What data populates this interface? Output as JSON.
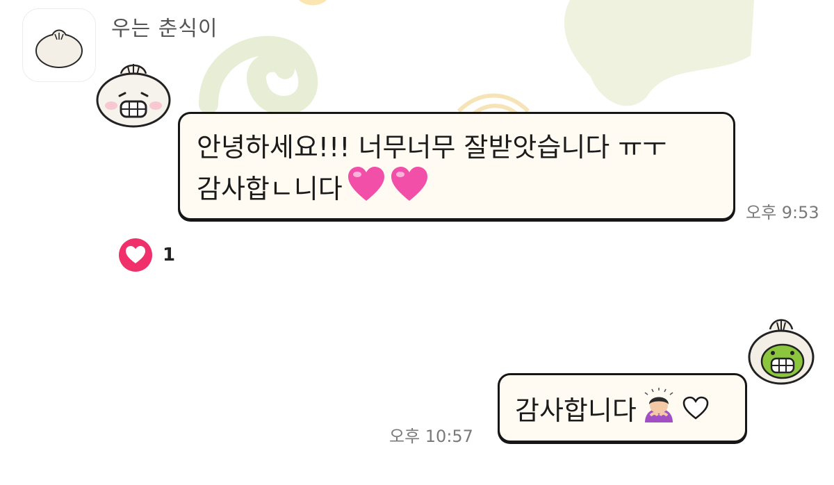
{
  "chat": {
    "sender_name": "우는 춘식이",
    "incoming": {
      "line1": "안녕하세요!!! 너무너무 잘받앗습니다 ㅠㅜ",
      "line2": "감사합ㄴ니다",
      "time": "오후 9:53",
      "reaction_count": "1"
    },
    "outgoing": {
      "text": "감사합니다",
      "time": "오후 10:57"
    }
  },
  "icons": {
    "avatar": "dumpling-icon",
    "sticker_in": "dumpling-face-sticker-icon",
    "sticker_out": "green-dumpling-sticker-icon",
    "reaction": "heart-reaction-icon",
    "emoji_heart": "pink-heart-emoji-icon",
    "emoji_bow": "bowing-person-emoji-icon",
    "emoji_outline_heart": "white-heart-emoji-icon"
  },
  "colors": {
    "bubble_bg": "#fffbf2",
    "bubble_border": "#161616",
    "reaction_pink": "#f0306a",
    "heart_pink": "#f24fa8",
    "sticker_green": "#8cc63e"
  }
}
